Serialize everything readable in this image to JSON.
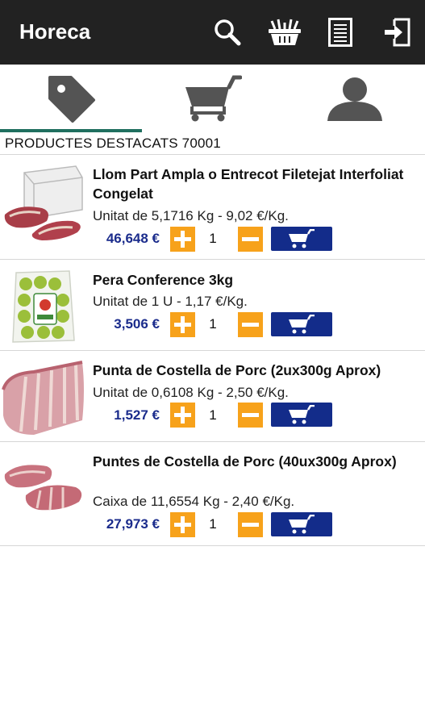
{
  "app": {
    "title": "Horeca"
  },
  "toolbar": {
    "icons": [
      "search-icon",
      "basket-icon",
      "document-list-icon",
      "logout-icon"
    ]
  },
  "tabs": [
    "tag-icon",
    "shopping-cart-icon",
    "user-icon"
  ],
  "section": {
    "title": "PRODUCTES DESTACATS 70001"
  },
  "colors": {
    "appbar": "#222222",
    "accent": "#f7a21b",
    "cart": "#132c8a",
    "price": "#1b2c8c",
    "tab_indicator": "#1f6f5f"
  },
  "products": [
    {
      "name": "Llom Part Ampla o Entrecot Filetejat Interfoliat Congelat",
      "desc": "Unitat de 5,1716 Kg - 9,02 €/Kg.",
      "price": "46,648 €",
      "qty": "1",
      "image": "boxed-meat-image"
    },
    {
      "name": "Pera Conference 3kg",
      "desc": "Unitat de 1 U - 1,17 €/Kg.",
      "price": "3,506 €",
      "qty": "1",
      "image": "pear-bag-image"
    },
    {
      "name": "Punta de Costella de Porc (2ux300g Aprox)",
      "desc": "Unitat de 0,6108 Kg - 2,50 €/Kg.",
      "price": "1,527 €",
      "qty": "1",
      "image": "pork-ribs-image"
    },
    {
      "name": "Puntes de Costella de Porc (40ux300g Aprox)",
      "desc": "Caixa de 11,6554 Kg - 2,40 €/Kg.",
      "price": "27,973 €",
      "qty": "1",
      "image": "pork-ribs-pieces-image"
    }
  ]
}
